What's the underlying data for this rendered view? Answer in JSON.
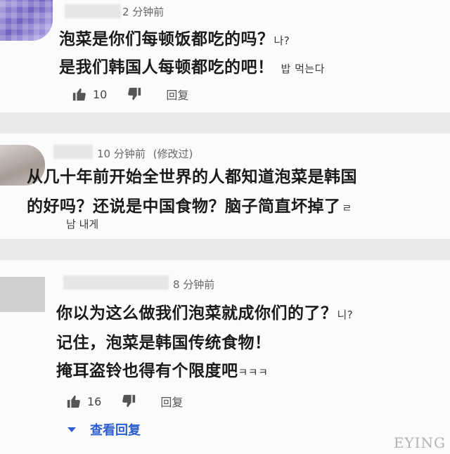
{
  "comments": [
    {
      "time": "2 分钟前",
      "edited": "",
      "lines": [
        "泡菜是你们每顿饭都吃的吗？",
        "是我们韩国人每顿都吃的吧！"
      ],
      "korean_overlays": [
        "나?",
        "밥 먹는다"
      ],
      "likes": "10",
      "reply_label": "回复"
    },
    {
      "time": "10 分钟前",
      "edited": "(修改过)",
      "lines": [
        "从几十年前开始全世界的人都知道泡菜是韩国",
        "的好吗？还说是中国食物？脑子简直坏掉了"
      ],
      "korean_overlays": [
        "남 내게",
        "ㄹ"
      ],
      "likes": "",
      "reply_label": ""
    },
    {
      "time": "8 分钟前",
      "edited": "",
      "lines": [
        "你以为这么做我们泡菜就成你们的了？",
        "记住，泡菜是韩国传统食物！",
        "掩耳盗铃也得有个限度吧"
      ],
      "korean_overlays": [
        "니?",
        "ㅋㅋㅋ"
      ],
      "likes": "16",
      "reply_label": "回复",
      "view_replies_label": "查看回复"
    }
  ],
  "icons": {
    "like": "thumbs-up-icon",
    "dislike": "thumbs-down-icon",
    "expand": "caret-down-icon"
  },
  "watermark": "EYING"
}
